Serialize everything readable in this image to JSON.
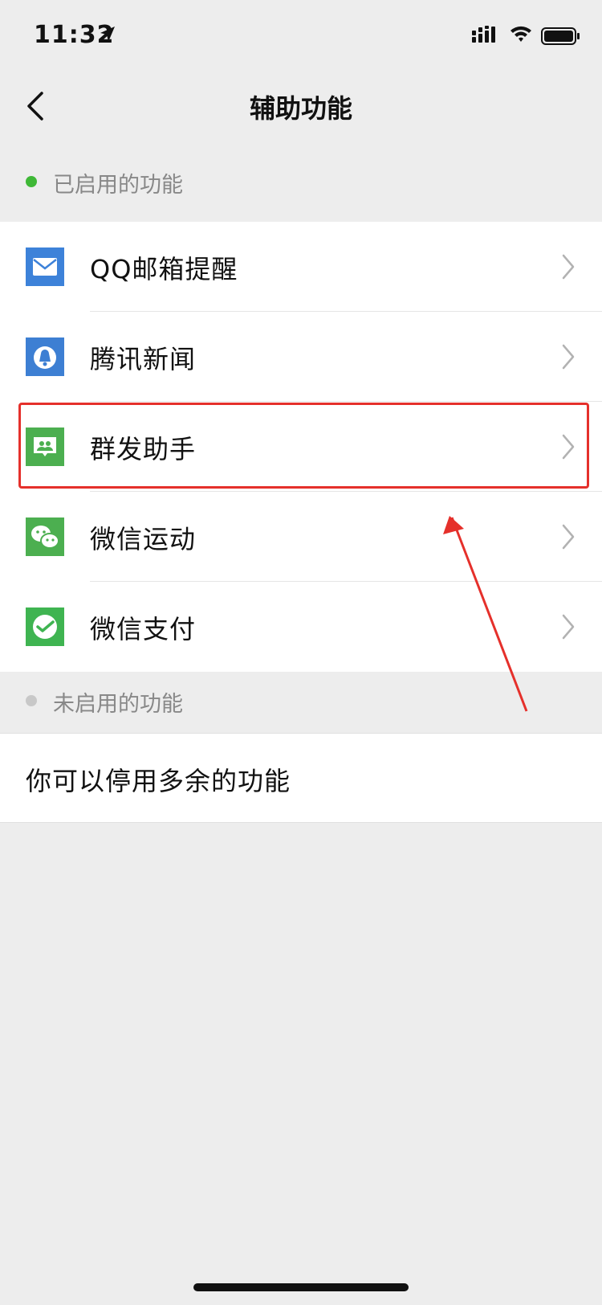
{
  "status_bar": {
    "time": "11:32"
  },
  "nav": {
    "title": "辅助功能"
  },
  "enabled_section": {
    "label": "已启用的功能",
    "dot_color": "#3fb837",
    "items": [
      {
        "label": "QQ邮箱提醒",
        "icon": "qq-mail-icon",
        "icon_color": "#3d82d9"
      },
      {
        "label": "腾讯新闻",
        "icon": "tencent-news-icon",
        "icon_color": "#3d7fd3"
      },
      {
        "label": "群发助手",
        "icon": "mass-message-icon",
        "icon_color": "#4caf50"
      },
      {
        "label": "微信运动",
        "icon": "wechat-sport-icon",
        "icon_color": "#4caf50"
      },
      {
        "label": "微信支付",
        "icon": "wechat-pay-icon",
        "icon_color": "#3fb451"
      }
    ]
  },
  "disabled_section": {
    "label": "未启用的功能",
    "dot_color": "#c8c8c8",
    "tip": "你可以停用多余的功能"
  },
  "annotation": {
    "highlight_color": "#e5302b"
  }
}
